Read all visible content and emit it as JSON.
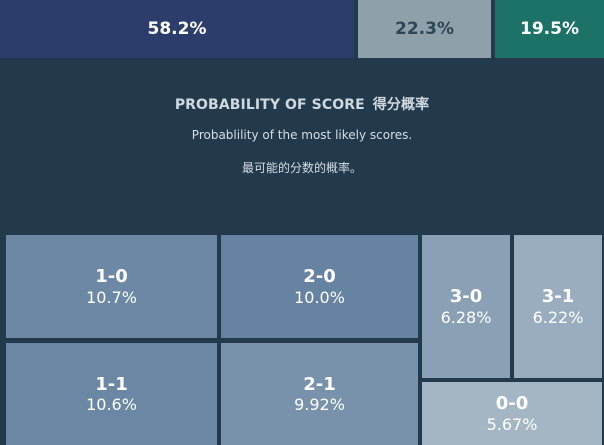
{
  "outcome_bar": {
    "home_win": "58.2%",
    "draw": "22.3%",
    "away_win": "19.5%",
    "colors": {
      "home": "#2d3d6b",
      "draw": "#8fa0aa",
      "away": "#1d7268"
    }
  },
  "section": {
    "title": "PROBABILITY OF SCORE",
    "title_zh": "得分概率",
    "subtitle": "Probablility of the most likely scores.",
    "subtitle_zh": "最可能的分数的概率。"
  },
  "scores": [
    {
      "score": "1-0",
      "probability": "10.7%"
    },
    {
      "score": "2-0",
      "probability": "10.0%"
    },
    {
      "score": "1-1",
      "probability": "10.6%"
    },
    {
      "score": "2-1",
      "probability": "9.92%"
    },
    {
      "score": "3-0",
      "probability": "6.28%"
    },
    {
      "score": "3-1",
      "probability": "6.22%"
    },
    {
      "score": "0-0",
      "probability": "5.67%"
    }
  ],
  "colors": {
    "background": "#233a4d"
  }
}
